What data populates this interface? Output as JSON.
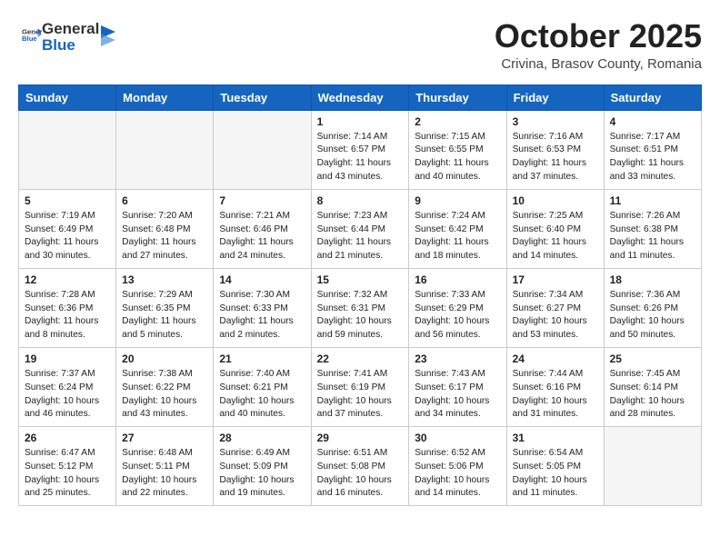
{
  "header": {
    "logo_general": "General",
    "logo_blue": "Blue",
    "month": "October 2025",
    "location": "Crivina, Brasov County, Romania"
  },
  "weekdays": [
    "Sunday",
    "Monday",
    "Tuesday",
    "Wednesday",
    "Thursday",
    "Friday",
    "Saturday"
  ],
  "weeks": [
    [
      {
        "day": "",
        "info": ""
      },
      {
        "day": "",
        "info": ""
      },
      {
        "day": "",
        "info": ""
      },
      {
        "day": "1",
        "info": "Sunrise: 7:14 AM\nSunset: 6:57 PM\nDaylight: 11 hours\nand 43 minutes."
      },
      {
        "day": "2",
        "info": "Sunrise: 7:15 AM\nSunset: 6:55 PM\nDaylight: 11 hours\nand 40 minutes."
      },
      {
        "day": "3",
        "info": "Sunrise: 7:16 AM\nSunset: 6:53 PM\nDaylight: 11 hours\nand 37 minutes."
      },
      {
        "day": "4",
        "info": "Sunrise: 7:17 AM\nSunset: 6:51 PM\nDaylight: 11 hours\nand 33 minutes."
      }
    ],
    [
      {
        "day": "5",
        "info": "Sunrise: 7:19 AM\nSunset: 6:49 PM\nDaylight: 11 hours\nand 30 minutes."
      },
      {
        "day": "6",
        "info": "Sunrise: 7:20 AM\nSunset: 6:48 PM\nDaylight: 11 hours\nand 27 minutes."
      },
      {
        "day": "7",
        "info": "Sunrise: 7:21 AM\nSunset: 6:46 PM\nDaylight: 11 hours\nand 24 minutes."
      },
      {
        "day": "8",
        "info": "Sunrise: 7:23 AM\nSunset: 6:44 PM\nDaylight: 11 hours\nand 21 minutes."
      },
      {
        "day": "9",
        "info": "Sunrise: 7:24 AM\nSunset: 6:42 PM\nDaylight: 11 hours\nand 18 minutes."
      },
      {
        "day": "10",
        "info": "Sunrise: 7:25 AM\nSunset: 6:40 PM\nDaylight: 11 hours\nand 14 minutes."
      },
      {
        "day": "11",
        "info": "Sunrise: 7:26 AM\nSunset: 6:38 PM\nDaylight: 11 hours\nand 11 minutes."
      }
    ],
    [
      {
        "day": "12",
        "info": "Sunrise: 7:28 AM\nSunset: 6:36 PM\nDaylight: 11 hours\nand 8 minutes."
      },
      {
        "day": "13",
        "info": "Sunrise: 7:29 AM\nSunset: 6:35 PM\nDaylight: 11 hours\nand 5 minutes."
      },
      {
        "day": "14",
        "info": "Sunrise: 7:30 AM\nSunset: 6:33 PM\nDaylight: 11 hours\nand 2 minutes."
      },
      {
        "day": "15",
        "info": "Sunrise: 7:32 AM\nSunset: 6:31 PM\nDaylight: 10 hours\nand 59 minutes."
      },
      {
        "day": "16",
        "info": "Sunrise: 7:33 AM\nSunset: 6:29 PM\nDaylight: 10 hours\nand 56 minutes."
      },
      {
        "day": "17",
        "info": "Sunrise: 7:34 AM\nSunset: 6:27 PM\nDaylight: 10 hours\nand 53 minutes."
      },
      {
        "day": "18",
        "info": "Sunrise: 7:36 AM\nSunset: 6:26 PM\nDaylight: 10 hours\nand 50 minutes."
      }
    ],
    [
      {
        "day": "19",
        "info": "Sunrise: 7:37 AM\nSunset: 6:24 PM\nDaylight: 10 hours\nand 46 minutes."
      },
      {
        "day": "20",
        "info": "Sunrise: 7:38 AM\nSunset: 6:22 PM\nDaylight: 10 hours\nand 43 minutes."
      },
      {
        "day": "21",
        "info": "Sunrise: 7:40 AM\nSunset: 6:21 PM\nDaylight: 10 hours\nand 40 minutes."
      },
      {
        "day": "22",
        "info": "Sunrise: 7:41 AM\nSunset: 6:19 PM\nDaylight: 10 hours\nand 37 minutes."
      },
      {
        "day": "23",
        "info": "Sunrise: 7:43 AM\nSunset: 6:17 PM\nDaylight: 10 hours\nand 34 minutes."
      },
      {
        "day": "24",
        "info": "Sunrise: 7:44 AM\nSunset: 6:16 PM\nDaylight: 10 hours\nand 31 minutes."
      },
      {
        "day": "25",
        "info": "Sunrise: 7:45 AM\nSunset: 6:14 PM\nDaylight: 10 hours\nand 28 minutes."
      }
    ],
    [
      {
        "day": "26",
        "info": "Sunrise: 6:47 AM\nSunset: 5:12 PM\nDaylight: 10 hours\nand 25 minutes."
      },
      {
        "day": "27",
        "info": "Sunrise: 6:48 AM\nSunset: 5:11 PM\nDaylight: 10 hours\nand 22 minutes."
      },
      {
        "day": "28",
        "info": "Sunrise: 6:49 AM\nSunset: 5:09 PM\nDaylight: 10 hours\nand 19 minutes."
      },
      {
        "day": "29",
        "info": "Sunrise: 6:51 AM\nSunset: 5:08 PM\nDaylight: 10 hours\nand 16 minutes."
      },
      {
        "day": "30",
        "info": "Sunrise: 6:52 AM\nSunset: 5:06 PM\nDaylight: 10 hours\nand 14 minutes."
      },
      {
        "day": "31",
        "info": "Sunrise: 6:54 AM\nSunset: 5:05 PM\nDaylight: 10 hours\nand 11 minutes."
      },
      {
        "day": "",
        "info": ""
      }
    ]
  ]
}
